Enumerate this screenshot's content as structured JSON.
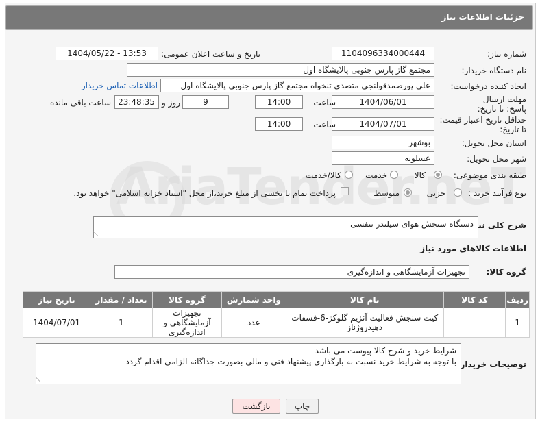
{
  "header": {
    "title": "جزئیات اطلاعات نیاز"
  },
  "form": {
    "need_number_label": "شماره نیاز:",
    "need_number": "1104096334000444",
    "announce_label": "تاریخ و ساعت اعلان عمومی:",
    "announce_value": "1404/05/22 - 13:53",
    "buyer_org_label": "نام دستگاه خریدار:",
    "buyer_org": "مجتمع گاز پارس جنوبی  پالایشگاه اول",
    "requester_label": "ایجاد کننده درخواست:",
    "requester": "علی پورصمدقولنجی متصدی تنخواه مجتمع گاز پارس جنوبی  پالایشگاه اول",
    "contact_link": "اطلاعات تماس خریدار",
    "reply_deadline_label": "مهلت ارسال پاسخ: تا تاریخ:",
    "reply_date": "1404/06/01",
    "time_label": "ساعت",
    "reply_time": "14:00",
    "days_value": "9",
    "days_label": "روز و",
    "remaining_value": "23:48:35",
    "remaining_label": "ساعت باقی مانده",
    "price_validity_label": "حداقل تاریخ اعتبار قیمت: تا تاریخ:",
    "price_date": "1404/07/01",
    "price_time_label": "ساعت",
    "price_time": "14:00",
    "province_label": "استان محل تحویل:",
    "province": "بوشهر",
    "city_label": "شهر محل تحویل:",
    "city": "عسلویه",
    "category_label": "طبقه بندی موضوعی:",
    "category_options": [
      "کالا",
      "خدمت",
      "کالا/خدمت"
    ],
    "category_selected": "کالا",
    "process_label": "نوع فرآیند خرید :",
    "process_options": [
      "جزیی",
      "متوسط"
    ],
    "process_selected": "متوسط",
    "payment_note": "پرداخت تمام یا بخشی از مبلغ خرید،از محل \"اسناد خزانه اسلامی\" خواهد بود."
  },
  "description": {
    "label": "شرح کلی نیاز:",
    "value": "دستگاه سنجش هوای سیلندر تنفسی"
  },
  "items_section": {
    "title": "اطلاعات کالاهای مورد نیاز",
    "group_label": "گروه کالا:",
    "group_value": "تجهیزات آزمایشگاهی و اندازه‌گیری",
    "columns": [
      "ردیف",
      "کد کالا",
      "نام کالا",
      "واحد شمارش",
      "گروه کالا",
      "تعداد / مقدار",
      "تاریخ نیاز"
    ],
    "rows": [
      {
        "row": "1",
        "code": "--",
        "name": "کیت سنجش فعالیت آنزیم گلوکز-6-فسفات دهیدروژناز",
        "unit": "عدد",
        "group": "تجهیزات آزمایشگاهی و اندازه‌گیری",
        "qty": "1",
        "date": "1404/07/01"
      }
    ]
  },
  "buyer_notes": {
    "label": "توضیحات خریدار:",
    "line1": "شرایط خرید و شرح کالا  پیوست می باشد",
    "line2": "با توجه به شرایط خرید نسبت به بارگذاری پیشنهاد فنی و مالی بصورت جداگانه الزامی اقدام گردد"
  },
  "buttons": {
    "print": "چاپ",
    "back": "بازگشت"
  },
  "watermark": "AriaTender.neT",
  "colors": {
    "header_bg": "#787878",
    "link": "#1a5fb4",
    "back_btn_bg": "#fde3e3"
  }
}
